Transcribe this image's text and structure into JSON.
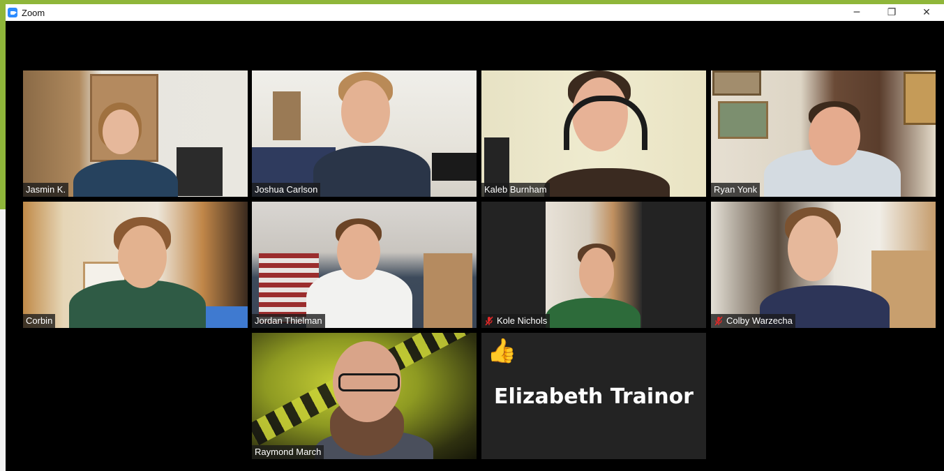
{
  "window": {
    "title": "Zoom",
    "controls": {
      "minimize": "─",
      "restore": "❐",
      "close": "✕"
    }
  },
  "participants": [
    {
      "name": "Jasmin K.",
      "muted": false
    },
    {
      "name": "Joshua Carlson",
      "muted": false
    },
    {
      "name": "Kaleb Burnham",
      "muted": false
    },
    {
      "name": "Ryan Yonk",
      "muted": false
    },
    {
      "name": "Corbin",
      "muted": false
    },
    {
      "name": "Jordan Thielman",
      "muted": false
    },
    {
      "name": "Kole Nichols",
      "muted": true
    },
    {
      "name": "Colby Warzecha",
      "muted": true
    },
    {
      "name": "Raymond March",
      "muted": false
    },
    {
      "name": "Elizabeth Trainor",
      "muted": false,
      "video_off": true,
      "reaction": "👍"
    }
  ],
  "colors": {
    "zoom_blue": "#2d8cff",
    "tile_off_bg": "#232323",
    "mute_red": "#e02828",
    "desktop_green": "#8fb63a"
  },
  "icons": {
    "app": "zoom-logo-icon",
    "mute": "microphone-muted-icon",
    "reaction": "thumbs-up-icon"
  }
}
